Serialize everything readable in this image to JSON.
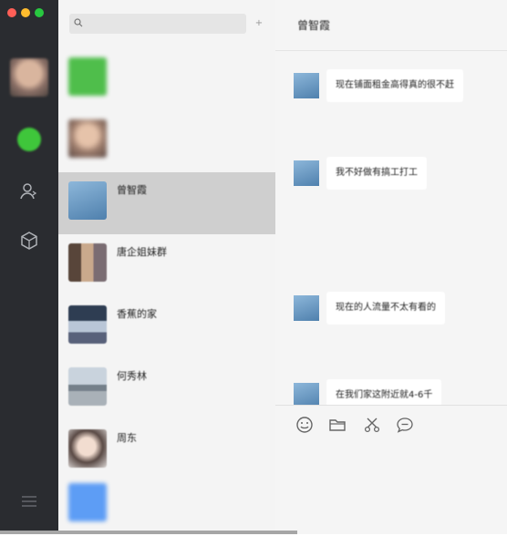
{
  "window": {
    "traffic_lights": [
      "#ff5f57",
      "#febc2e",
      "#28c840"
    ]
  },
  "search": {
    "placeholder": "",
    "plus_label": "+"
  },
  "conversations": [
    {
      "name": "",
      "time": "",
      "preview": ""
    },
    {
      "name": "",
      "time": "",
      "preview": ""
    },
    {
      "name": "曾智霞",
      "time": "",
      "preview": ""
    },
    {
      "name": "唐企姐妹群",
      "time": "",
      "preview": ""
    },
    {
      "name": "香蕉的家",
      "time": "",
      "preview": ""
    },
    {
      "name": "何秀林",
      "time": "",
      "preview": ""
    },
    {
      "name": "周东",
      "time": "",
      "preview": ""
    },
    {
      "name": "",
      "time": "",
      "preview": ""
    }
  ],
  "chat": {
    "title": "曾智霞",
    "messages": [
      {
        "text": "现在铺面租金高得真的很不赶"
      },
      {
        "text": "我不好做有搞工打工"
      },
      {
        "text": "现在的人流量不太有看的"
      },
      {
        "text": "在我们家这附近就4-6千"
      }
    ]
  },
  "icons": {
    "rail": [
      "avatar",
      "chat-icon",
      "contacts-icon",
      "favorites-icon",
      "menu-icon"
    ],
    "toolbar": [
      "emoji-icon",
      "folder-icon",
      "scissors-icon",
      "chat-bubble-icon"
    ]
  },
  "colors": {
    "rail": "#2a2c30",
    "active_item": "#cfcfcf",
    "accent_green": "#3fc63b"
  }
}
